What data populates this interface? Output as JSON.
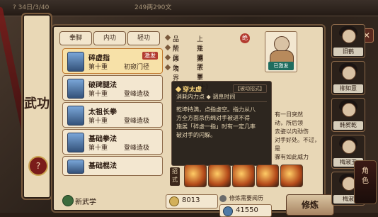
{
  "top": {
    "seg1": "? 34日/3/40",
    "seg2": "249两290文"
  },
  "left_scroll": {
    "title": "武功",
    "badge": "?"
  },
  "tabs": [
    "拳脚",
    "内功",
    "轻功"
  ],
  "skills": [
    {
      "name": "碎虚指",
      "level": "第十重",
      "stage": "初窥门径",
      "chip": "激发",
      "selected": true
    },
    {
      "name": "破碑腿法",
      "level": "第十重",
      "stage": "登峰造极"
    },
    {
      "name": "太祖长拳",
      "level": "第十重",
      "stage": "登峰造极"
    },
    {
      "name": "基础拳法",
      "level": "第十重",
      "stage": "登峰造极"
    },
    {
      "name": "基础棍法",
      "level": "",
      "stage": ""
    }
  ],
  "info": {
    "品阶": "上乘武学",
    "所属": "江湖武学",
    "修为": "第十重(十)",
    "境界": "",
    "seal": "绝"
  },
  "portrait": {
    "tag": "已激发"
  },
  "tooltip": {
    "title": "穿太虚",
    "mode": "【被动招式】",
    "line1": "消耗内力点  ◆  调息时间",
    "line2": "乾坤持满，点指虚空。指力从八",
    "line3": "方全方面杀伤绵对手被进不得",
    "line4": "施展「碎虚一指」时有一定几率",
    "line5": "破对手的闪躲。"
  },
  "description": {
    "text": "有一日突然\n动，所后领\n去姿以内劲伤\n对手好处。不过，是\n骤有如此威力"
  },
  "moves_label": "招式",
  "new_learn": "新武学",
  "coins": "8013",
  "deepen_label": "修炼需要阅历",
  "cost": "41550",
  "train_button": "修炼",
  "characters": [
    "旧鹤",
    "柳如意",
    "韩贺乾",
    "梅淑玉",
    "梅淑"
  ],
  "role_button": "角色"
}
